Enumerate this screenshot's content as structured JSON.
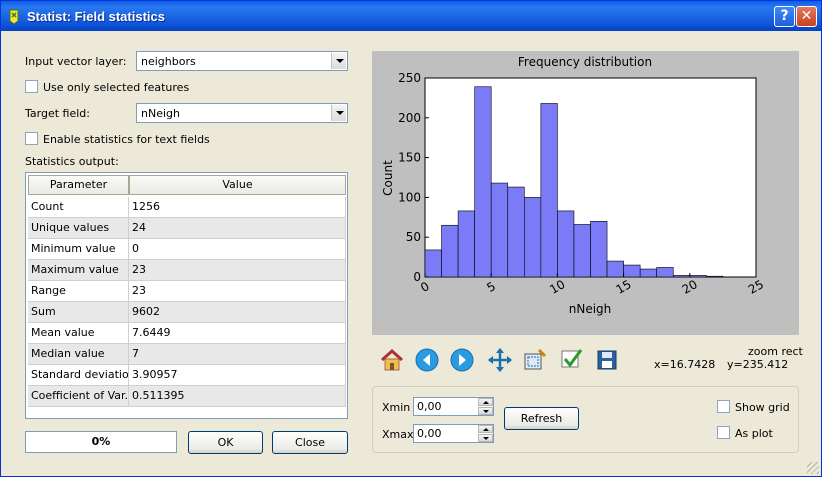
{
  "window": {
    "title": "Statist: Field statistics",
    "help_label": "?",
    "close_label": "✕"
  },
  "form": {
    "input_layer_label": "Input vector layer:",
    "input_layer_value": "neighbors",
    "use_selected_label": "Use only selected features",
    "target_field_label": "Target field:",
    "target_field_value": "nNeigh",
    "text_fields_label": "Enable statistics for text fields",
    "stats_output_label": "Statistics output:"
  },
  "table": {
    "headers": [
      "Parameter",
      "Value"
    ],
    "rows": [
      {
        "param": "Count",
        "value": "1256"
      },
      {
        "param": "Unique values",
        "value": "24"
      },
      {
        "param": "Minimum value",
        "value": "0"
      },
      {
        "param": "Maximum value",
        "value": "23"
      },
      {
        "param": "Range",
        "value": "23"
      },
      {
        "param": "Sum",
        "value": "9602"
      },
      {
        "param": "Mean value",
        "value": "7.6449"
      },
      {
        "param": "Median value",
        "value": "7"
      },
      {
        "param": "Standard deviation",
        "value": "3.90957"
      },
      {
        "param": "Coefficient of Var...",
        "value": "0.511395"
      }
    ]
  },
  "progress": {
    "label": "0%",
    "value": 0
  },
  "buttons": {
    "ok": "OK",
    "close": "Close",
    "refresh": "Refresh"
  },
  "toolbar": {
    "icons": [
      "home-icon",
      "back-icon",
      "forward-icon",
      "pan-icon",
      "zoom-rect-icon",
      "subplots-icon",
      "save-icon"
    ],
    "mode": "zoom rect",
    "x_readout": "x=16.7428",
    "y_readout": "y=235.412"
  },
  "range": {
    "xmin_label": "Xmin",
    "xmin_value": "0,00",
    "xmax_label": "Xmax",
    "xmax_value": "0,00",
    "show_grid_label": "Show grid",
    "as_plot_label": "As plot"
  },
  "chart_data": {
    "type": "bar",
    "title": "Frequency distribution",
    "xlabel": "nNeigh",
    "ylabel": "Count",
    "xlim": [
      0,
      25
    ],
    "ylim": [
      0,
      250
    ],
    "xticks": [
      "0",
      "5",
      "10",
      "15",
      "20",
      "25"
    ],
    "yticks": [
      "0",
      "50",
      "100",
      "150",
      "200",
      "250"
    ],
    "bin_edges": [
      0,
      1.25,
      2.5,
      3.75,
      5,
      6.25,
      7.5,
      8.75,
      10,
      11.25,
      12.5,
      13.75,
      15,
      16.25,
      17.5,
      18.75,
      20,
      21.25,
      22.5,
      23.75
    ],
    "values": [
      34,
      65,
      83,
      239,
      118,
      113,
      100,
      218,
      83,
      66,
      70,
      20,
      15,
      10,
      12,
      2,
      2,
      1,
      0
    ],
    "bar_color": "#7b7bf7",
    "grid": false
  }
}
